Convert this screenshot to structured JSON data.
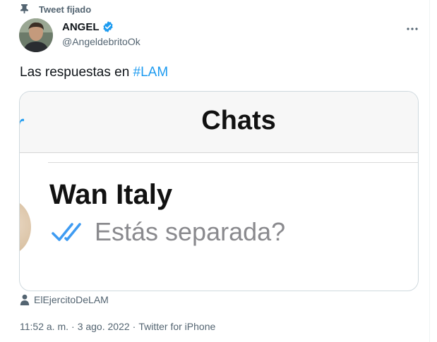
{
  "pinned": {
    "label": "Tweet fijado",
    "icon": "pin-icon"
  },
  "author": {
    "name": "ANGEL",
    "handle": "@AngeldebritoOk",
    "verified": true
  },
  "more": {
    "icon": "more-icon"
  },
  "tweet": {
    "text_before": "Las respuestas en ",
    "hashtag": "#LAM"
  },
  "media": {
    "screen_title": "Chats",
    "contact_name": "Wan Italy",
    "last_message": "Estás separada?"
  },
  "tagged": {
    "user": "ElEjercitoDeLAM",
    "icon": "person-icon"
  },
  "meta": {
    "time": "11:52 a. m.",
    "date": "3 ago. 2022",
    "source": "Twitter for iPhone",
    "separator": "·"
  },
  "colors": {
    "accent": "#1d9bf0",
    "secondary_text": "#536471",
    "text": "#0f1419"
  }
}
